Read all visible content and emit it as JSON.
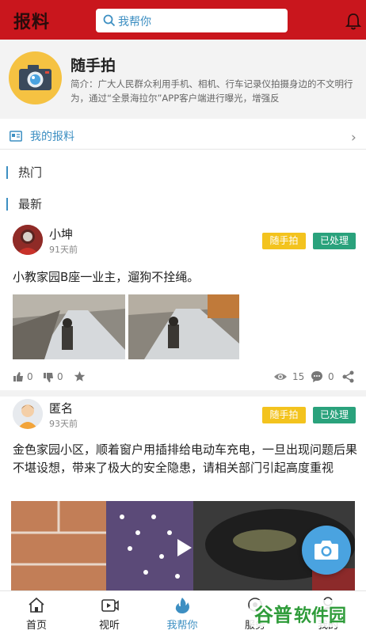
{
  "header": {
    "title": "报料",
    "search_placeholder": "我帮你"
  },
  "intro": {
    "name": "随手拍",
    "description": "简介：广大人民群众利用手机、相机、行车记录仪拍摄身边的不文明行为，通过“全景海拉尔”APP客户端进行曝光，增强反"
  },
  "my_report": {
    "label": "我的报料"
  },
  "sections": {
    "hot": "热门",
    "latest": "最新"
  },
  "posts": [
    {
      "user": "小坤",
      "time": "91天前",
      "category_tag": "随手拍",
      "status_tag": "已处理",
      "text": "小教家园B座一业主，遛狗不拴绳。",
      "likes": "0",
      "dislikes": "0",
      "views": "15",
      "comments": "0"
    },
    {
      "user": "匿名",
      "time": "93天前",
      "category_tag": "随手拍",
      "status_tag": "已处理",
      "text": "金色家园小区，顺着窗户用插排给电动车充电，一旦出现问题后果不堪设想，带来了极大的安全隐患，请相关部门引起高度重视"
    }
  ],
  "tabbar": {
    "items": [
      {
        "label": "首页",
        "icon": "home-icon"
      },
      {
        "label": "视听",
        "icon": "video-icon"
      },
      {
        "label": "我帮你",
        "icon": "flame-icon"
      },
      {
        "label": "服务",
        "icon": "service-icon"
      },
      {
        "label": "我的",
        "icon": "user-icon"
      }
    ],
    "active_index": 2
  },
  "watermark": "谷普软件园",
  "colors": {
    "header": "#c9161d",
    "accent": "#3d8fc2",
    "category_tag": "#f3c31e",
    "status_tag": "#2aa27c",
    "fab": "#4aa3e0"
  }
}
